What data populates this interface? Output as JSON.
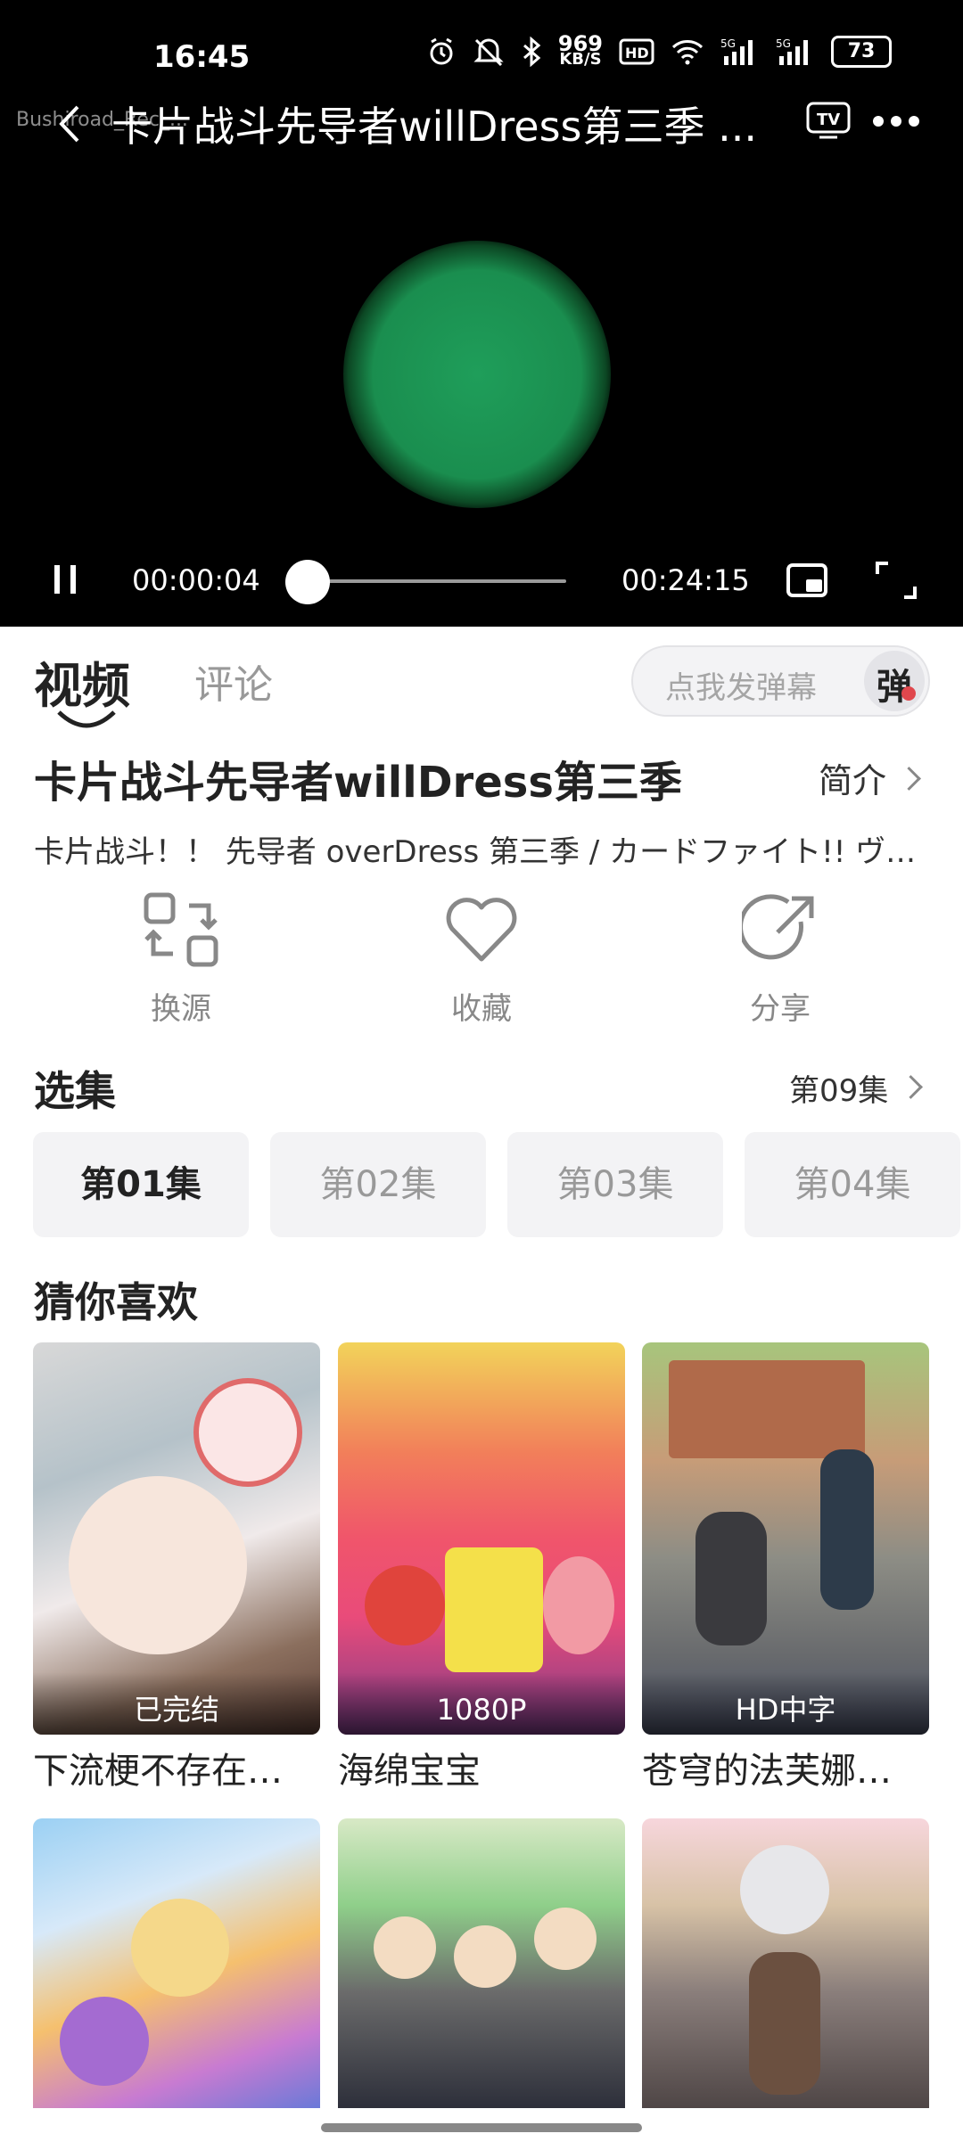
{
  "status_bar": {
    "time": "16:45",
    "speed_value": "969",
    "speed_unit": "KB/S",
    "battery": "73",
    "icons": [
      "alarm-icon",
      "mute-icon",
      "bluetooth-icon",
      "hd-icon",
      "wifi-icon",
      "5g-signal-icon",
      "5g-signal-icon"
    ]
  },
  "player": {
    "watermark": "Bushiroad_Rec_...",
    "title": "卡片战斗先导者willDress第三季 ...",
    "current_time": "00:00:04",
    "total_time": "00:24:15",
    "progress": 0.003
  },
  "tabs": {
    "video": "视频",
    "comments": "评论",
    "danmaku_placeholder": "点我发弹幕",
    "danmaku_icon": "弹"
  },
  "show": {
    "title": "卡片战斗先导者willDress第三季",
    "intro": "简介",
    "alt_titles": "卡片战斗！！ 先导者 overDress 第三季 / カードファイト!! ヴ…"
  },
  "actions": [
    {
      "label": "换源",
      "icon": "switch-source-icon"
    },
    {
      "label": "收藏",
      "icon": "heart-icon"
    },
    {
      "label": "分享",
      "icon": "share-icon"
    }
  ],
  "episodes": {
    "heading": "选集",
    "current": "第09集",
    "items": [
      "第01集",
      "第02集",
      "第03集",
      "第04集"
    ]
  },
  "recommendations": {
    "heading": "猜你喜欢",
    "items": [
      {
        "name": "下流梗不存在…",
        "badge": "已完结"
      },
      {
        "name": "海绵宝宝",
        "badge": "1080P"
      },
      {
        "name": "苍穹的法芙娜…",
        "badge": "HD中字"
      },
      {
        "name": "",
        "badge": ""
      },
      {
        "name": "",
        "badge": ""
      },
      {
        "name": "",
        "badge": ""
      }
    ]
  }
}
